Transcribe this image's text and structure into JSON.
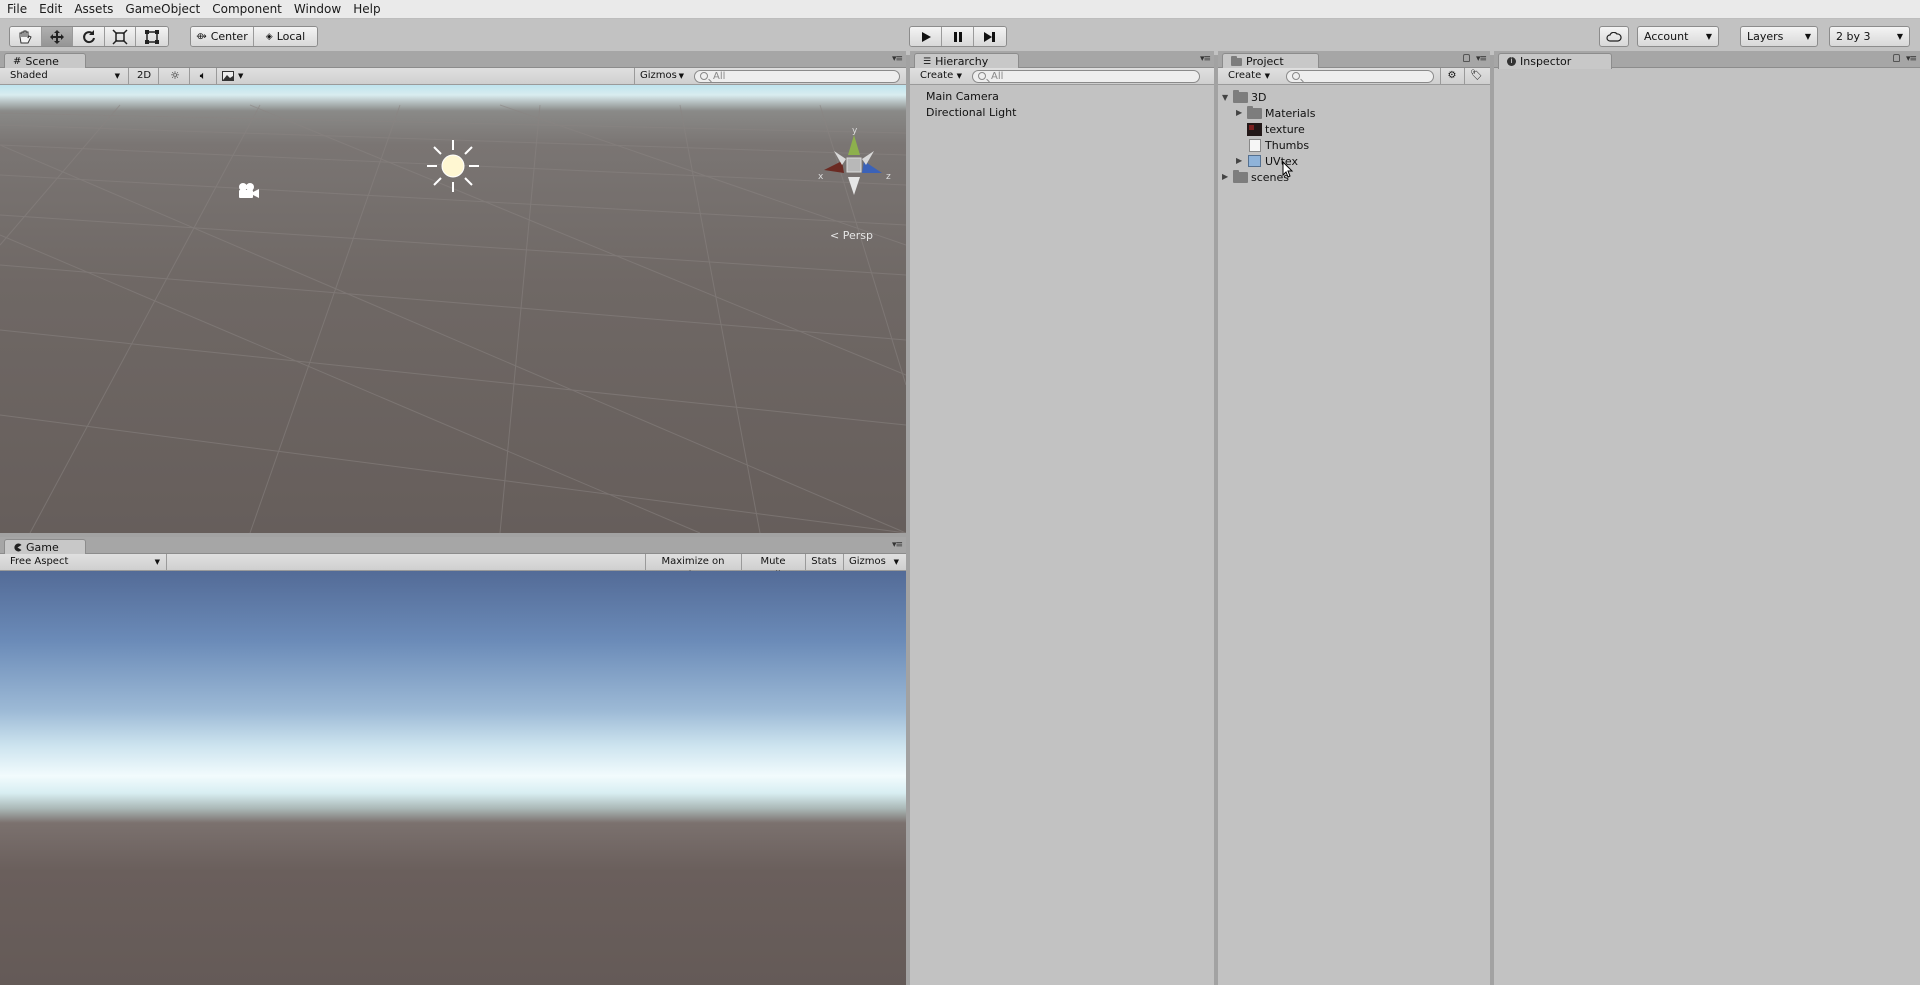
{
  "menu": [
    "File",
    "Edit",
    "Assets",
    "GameObject",
    "Component",
    "Window",
    "Help"
  ],
  "toolbar": {
    "pivot_label": "Center",
    "space_label": "Local",
    "account_label": "Account",
    "layers_label": "Layers",
    "layout_label": "2 by 3"
  },
  "scene": {
    "tab_label": "Scene",
    "shading_mode": "Shaded",
    "mode_2d": "2D",
    "gizmos_label": "Gizmos",
    "search_placeholder": "All",
    "persp_label": "Persp",
    "axis_x": "x",
    "axis_y": "y",
    "axis_z": "z"
  },
  "game": {
    "tab_label": "Game",
    "aspect_label": "Free Aspect",
    "maximize_label": "Maximize on Play",
    "mute_label": "Mute audio",
    "stats_label": "Stats",
    "gizmos_label": "Gizmos"
  },
  "hierarchy": {
    "tab_label": "Hierarchy",
    "create_label": "Create",
    "search_placeholder": "All",
    "items": [
      "Main Camera",
      "Directional Light"
    ]
  },
  "project": {
    "tab_label": "Project",
    "create_label": "Create",
    "items": {
      "root": "3D",
      "materials": "Materials",
      "texture": "texture",
      "thumbs": "Thumbs",
      "uvtex": "UVtex",
      "scenes": "scenes"
    }
  },
  "inspector": {
    "tab_label": "Inspector"
  },
  "colors": {
    "panel_bg": "#c2c2c2",
    "menubar_bg": "#eaeaea",
    "sky_top": "#536b97",
    "ground": "#665e5b"
  }
}
